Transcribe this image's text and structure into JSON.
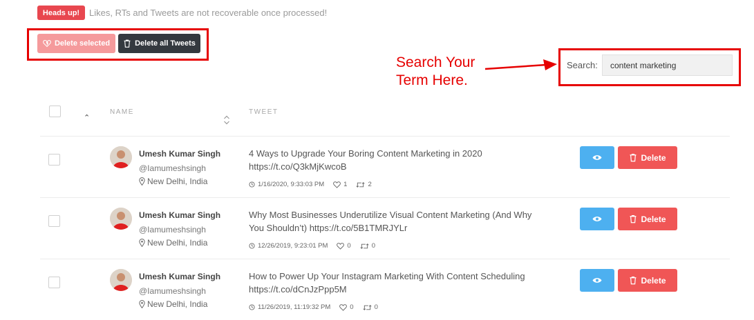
{
  "notice": {
    "badge": "Heads up!",
    "text": "Likes, RTs and Tweets are not recoverable once processed!"
  },
  "actions": {
    "delete_selected": "Delete selected",
    "delete_all": "Delete all Tweets"
  },
  "annotation": {
    "line1": "Search Your",
    "line2": "Term Here."
  },
  "search": {
    "label": "Search:",
    "value": "content marketing"
  },
  "table": {
    "columns": {
      "name": "NAME",
      "tweet": "TWEET"
    },
    "rows": [
      {
        "name": "Umesh Kumar Singh",
        "handle": "@Iamumeshsingh",
        "location": "New Delhi, India",
        "text_line1": "4 Ways to Upgrade Your Boring Content Marketing in 2020",
        "text_line2": "https://t.co/Q3kMjKwcoB",
        "date": "1/16/2020, 9:33:03 PM",
        "likes": "1",
        "retweets": "2",
        "delete_label": "Delete"
      },
      {
        "name": "Umesh Kumar Singh",
        "handle": "@Iamumeshsingh",
        "location": "New Delhi, India",
        "text_line1": "Why Most Businesses Underutilize Visual Content Marketing (And Why",
        "text_line2": "You Shouldn’t) https://t.co/5B1TMRJYLr",
        "date": "12/26/2019, 9:23:01 PM",
        "likes": "0",
        "retweets": "0",
        "delete_label": "Delete"
      },
      {
        "name": "Umesh Kumar Singh",
        "handle": "@Iamumeshsingh",
        "location": "New Delhi, India",
        "text_line1": "How to Power Up Your Instagram Marketing With Content Scheduling",
        "text_line2": "https://t.co/dCnJzPpp5M",
        "date": "11/26/2019, 11:19:32 PM",
        "likes": "0",
        "retweets": "0",
        "delete_label": "Delete"
      }
    ]
  },
  "colors": {
    "danger": "#f05656",
    "info": "#4db0f0",
    "dark": "#34393f",
    "annotation": "#e60000"
  }
}
